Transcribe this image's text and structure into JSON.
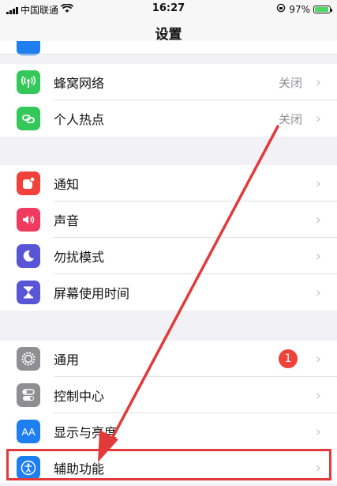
{
  "status_bar": {
    "carrier": "中国联通",
    "time": "16:27",
    "battery": "97%",
    "battery_level": 0.97
  },
  "nav": {
    "title": "设置"
  },
  "groups": [
    {
      "items": [
        {
          "label": "蜂窝网络",
          "value": "关闭",
          "icon": "cellular-antenna-icon",
          "color": "#34c759"
        },
        {
          "label": "个人热点",
          "value": "关闭",
          "icon": "hotspot-link-icon",
          "color": "#34c759"
        }
      ]
    },
    {
      "items": [
        {
          "label": "通知",
          "icon": "notification-icon",
          "color": "#f0413a"
        },
        {
          "label": "声音",
          "icon": "speaker-icon",
          "color": "#f03a5f"
        },
        {
          "label": "勿扰模式",
          "icon": "moon-icon",
          "color": "#5856d6"
        },
        {
          "label": "屏幕使用时间",
          "icon": "hourglass-icon",
          "color": "#5856d6"
        }
      ]
    },
    {
      "items": [
        {
          "label": "通用",
          "badge": "1",
          "icon": "gear-icon",
          "color": "#8e8e93"
        },
        {
          "label": "控制中心",
          "icon": "toggle-switches-icon",
          "color": "#8e8e93"
        },
        {
          "label": "显示与亮度",
          "icon": "display-aa-icon",
          "color": "#1f7ff0",
          "icon_text": "AA"
        },
        {
          "label": "辅助功能",
          "icon": "accessibility-person-icon",
          "color": "#1f7ff0"
        }
      ]
    }
  ],
  "colors": {
    "annotation": "#e23a3a"
  }
}
